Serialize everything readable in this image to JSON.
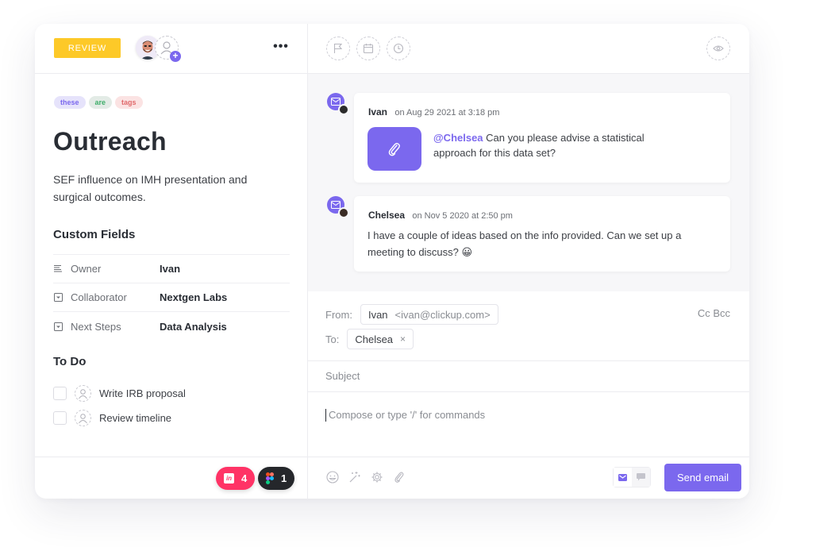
{
  "task": {
    "status": "REVIEW",
    "status_color": "#fdc928",
    "more_label": "•••",
    "tags": [
      {
        "label": "these",
        "color": "#7b68ee"
      },
      {
        "label": "are",
        "color": "#3fae6a"
      },
      {
        "label": "tags",
        "color": "#e0696b"
      }
    ],
    "title": "Outreach",
    "description": "SEF influence on IMH presentation and surgical outcomes."
  },
  "custom_fields": {
    "heading": "Custom Fields",
    "rows": [
      {
        "icon": "text-lines-icon",
        "label": "Owner",
        "value": "Ivan"
      },
      {
        "icon": "dropdown-icon",
        "label": "Collaborator",
        "value": "Nextgen Labs"
      },
      {
        "icon": "dropdown-icon",
        "label": "Next Steps",
        "value": "Data Analysis"
      }
    ]
  },
  "todo": {
    "heading": "To Do",
    "items": [
      {
        "label": "Write IRB proposal",
        "checked": false
      },
      {
        "label": "Review timeline",
        "checked": false
      }
    ]
  },
  "integrations": [
    {
      "name": "invision",
      "count": "4",
      "color": "#ff3366"
    },
    {
      "name": "figma",
      "count": "1",
      "color": "#25272b"
    }
  ],
  "toolbar": {
    "icons": [
      "flag-icon",
      "calendar-icon",
      "clock-icon"
    ],
    "watch_icon": "eye-icon"
  },
  "messages": [
    {
      "author": "Ivan",
      "time": "on Aug 29 2021 at 3:18 pm",
      "mention": "@Chelsea",
      "text": "Can you please advise a statistical approach for this data set?",
      "has_attachment": true
    },
    {
      "author": "Chelsea",
      "time": "on Nov 5 2020 at 2:50 pm",
      "text": "I have a couple of ideas based on the info provided. Can we set up a meeting to discuss? 😀"
    }
  ],
  "compose": {
    "from_label": "From:",
    "from_name": "Ivan",
    "from_email": "<ivan@clickup.com>",
    "to_label": "To:",
    "to_name": "Chelsea",
    "remove_label": "×",
    "cc_bcc": "Cc Bcc",
    "subject_placeholder": "Subject",
    "body_placeholder": "Compose or type '/' for commands",
    "send_label": "Send email",
    "accent": "#7b68ee"
  }
}
